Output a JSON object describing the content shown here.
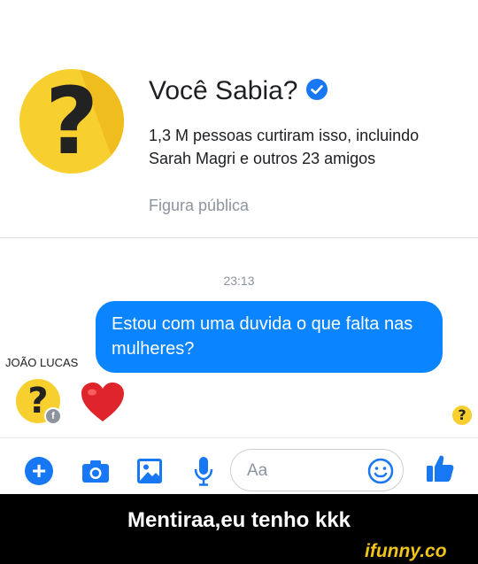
{
  "header": {
    "page_name": "Você Sabia?",
    "likes_text": "1,3 M pessoas curtiram isso, incluindo Sarah Magri e outros 23 amigos",
    "category": "Figura pública",
    "avatar_glyph": "?"
  },
  "chat": {
    "timestamp": "23:13",
    "message": "Estou com uma duvida o que falta nas mulheres?",
    "sender_name": "JOÃO LUCAS",
    "reply_icon": "red-heart-icon",
    "avatar_glyph": "?",
    "seen_glyph": "?"
  },
  "composer": {
    "placeholder": "Aa",
    "plus_label": "+"
  },
  "caption": "Mentiraa,eu tenho kkk",
  "watermark": "ifunny.co",
  "colors": {
    "accent": "#1877f2",
    "bubble": "#0a84ff",
    "avatar": "#f7cf2f",
    "heart": "#e0242c",
    "watermark": "#f0c419"
  }
}
